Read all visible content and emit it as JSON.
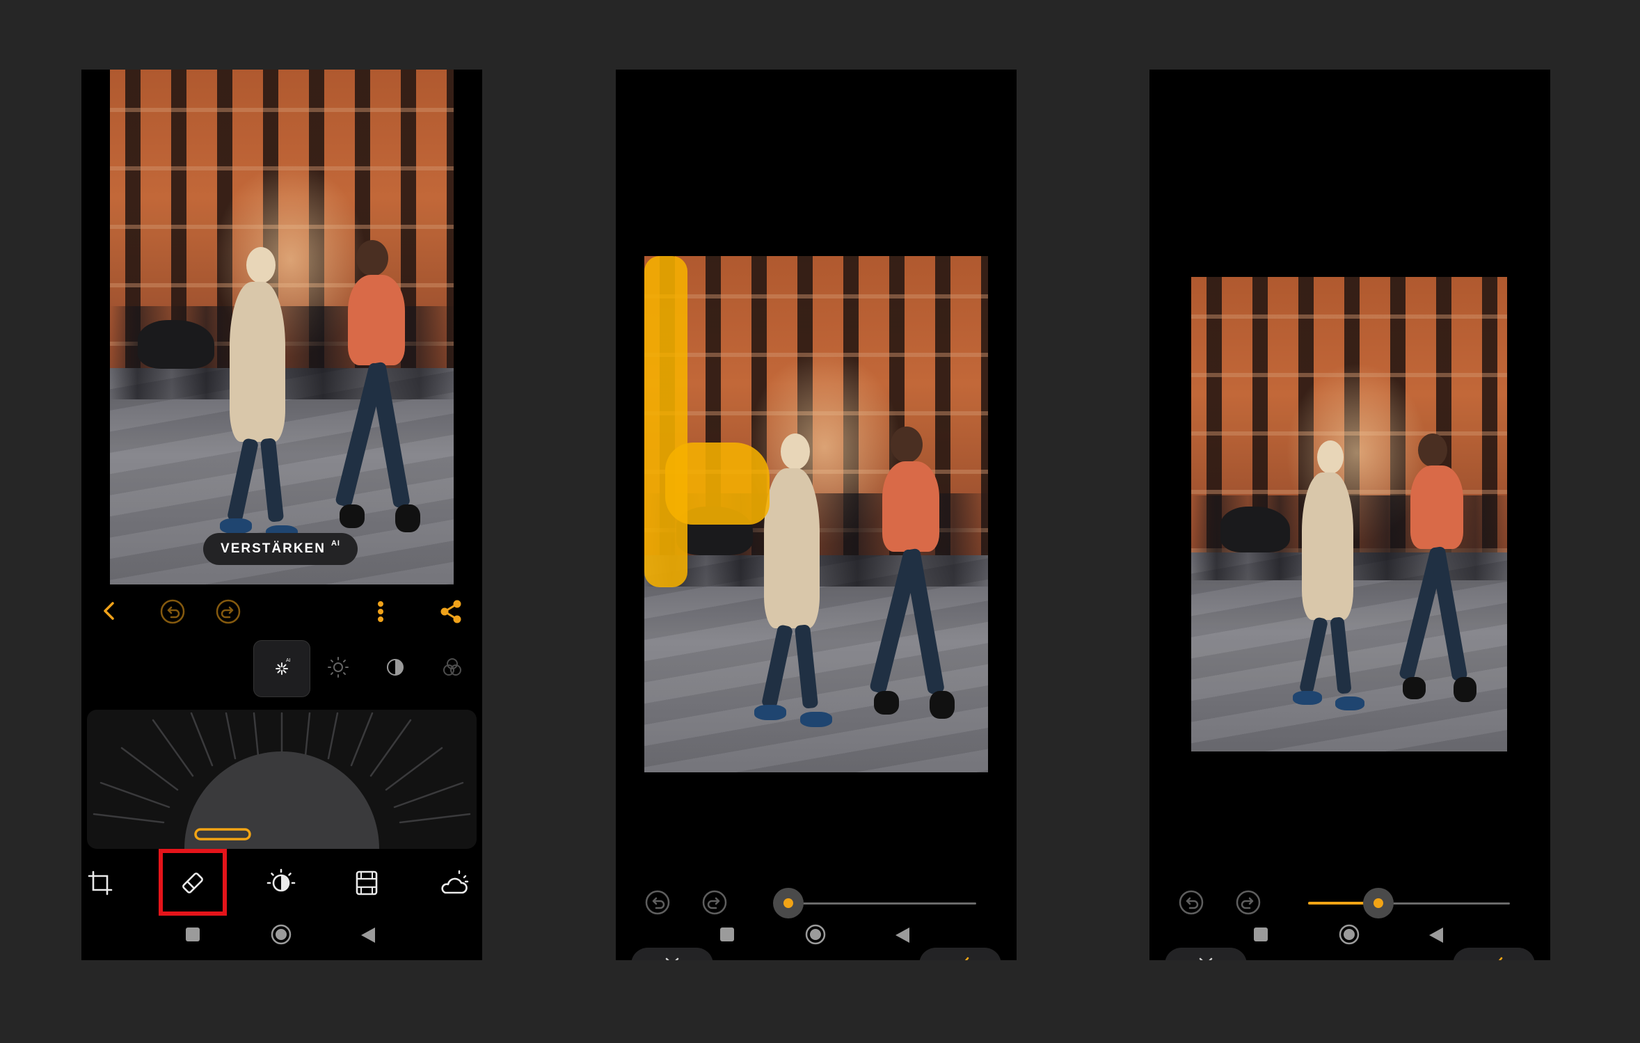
{
  "screens": [
    {
      "id": "editor",
      "enhance_button": {
        "label": "VERSTÄRKEN",
        "badge": "AI"
      },
      "toolbar": {
        "icons": [
          "back-icon",
          "undo-icon",
          "redo-icon",
          "more-icon",
          "share-icon"
        ]
      },
      "adjust_modes": {
        "active": "ai-enhance",
        "icons": [
          "ai-enhance-icon",
          "brightness-icon",
          "contrast-icon",
          "color-icon"
        ]
      },
      "dial": {
        "value_fraction": 0.0
      },
      "tabs": {
        "icons": [
          "crop-icon",
          "eraser-icon",
          "exposure-icon",
          "film-icon",
          "weather-icon"
        ],
        "highlighted": "eraser-icon"
      }
    },
    {
      "id": "eraser-brush",
      "brush_size": {
        "fraction": 0.0
      },
      "mask_color": "#f6b100",
      "actions": {
        "cancel_icon": "close-icon",
        "confirm_icon": "check-icon"
      }
    },
    {
      "id": "eraser-result",
      "brush_size": {
        "fraction": 0.35
      },
      "actions": {
        "cancel_icon": "close-icon",
        "confirm_icon": "check-icon"
      }
    }
  ],
  "system_nav": {
    "icons": [
      "recent-apps-icon",
      "home-icon",
      "back-triangle-icon"
    ]
  },
  "colors": {
    "background": "#262626",
    "accent": "#f2a415",
    "highlight": "#e5141a",
    "phone": "#000000"
  }
}
